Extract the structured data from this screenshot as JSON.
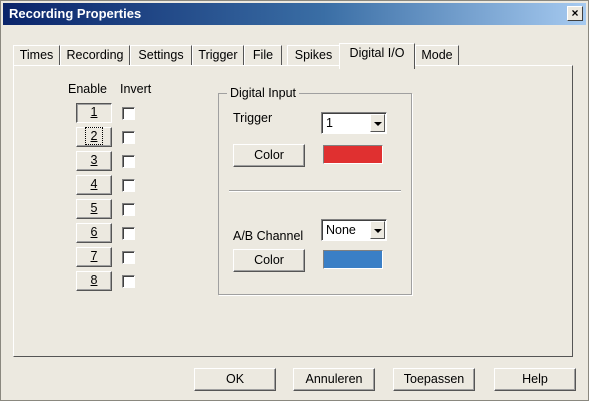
{
  "window": {
    "title": "Recording Properties",
    "close_glyph": "×"
  },
  "tabs": [
    {
      "label": "Times"
    },
    {
      "label": "Recording"
    },
    {
      "label": "Settings"
    },
    {
      "label": "Trigger"
    },
    {
      "label": "File"
    },
    {
      "label": "Spikes"
    },
    {
      "label": "Digital I/O",
      "active": true
    },
    {
      "label": "Mode"
    }
  ],
  "channels": {
    "enable_header": "Enable",
    "invert_header": "Invert",
    "buttons": [
      "1",
      "2",
      "3",
      "4",
      "5",
      "6",
      "7",
      "8"
    ],
    "pressed": "1",
    "focused": "2"
  },
  "digital_input": {
    "group_title": "Digital Input",
    "trigger_label": "Trigger",
    "trigger_value": "1",
    "trigger_color_button": "Color",
    "trigger_color": "#e03030",
    "ab_channel_label": "A/B Channel",
    "ab_channel_value": "None",
    "ab_color_button": "Color",
    "ab_color": "#3a7fc6"
  },
  "footer": {
    "ok": "OK",
    "cancel": "Annuleren",
    "apply": "Toepassen",
    "help": "Help"
  }
}
